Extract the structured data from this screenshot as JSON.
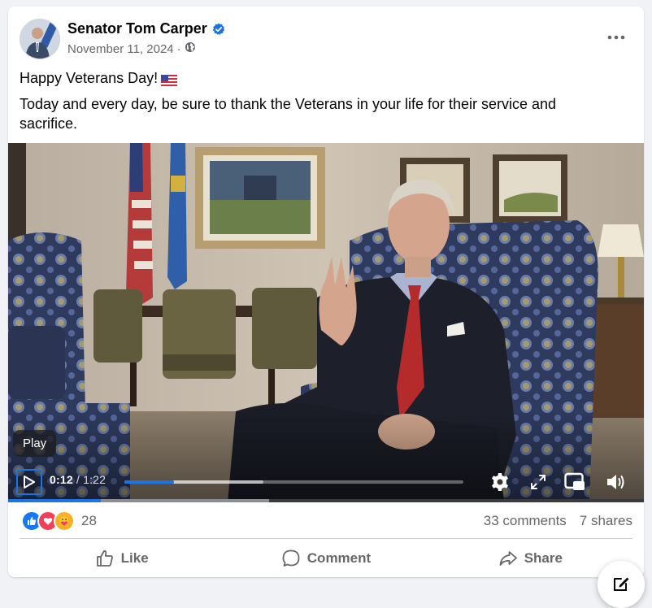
{
  "post": {
    "author": "Senator Tom Carper",
    "date": "November 11, 2024",
    "separator": "·",
    "visibility_icon": "globe-icon",
    "line1": "Happy Veterans Day!",
    "line2": "Today and every day, be sure to thank the Veterans in your life for their service and sacrifice."
  },
  "video": {
    "tooltip": "Play",
    "current_time": "0:12",
    "time_sep": " / ",
    "duration": "1:22",
    "progress_fraction": 0.146,
    "buffered_fraction": 0.41
  },
  "reactions": {
    "count": "28",
    "types": [
      "like-icon",
      "love-icon",
      "care-icon"
    ],
    "comments": "33 comments",
    "shares": "7 shares"
  },
  "actions": {
    "like": "Like",
    "comment": "Comment",
    "share": "Share"
  },
  "colors": {
    "accent": "#1b74e4",
    "like": "#1877f2",
    "love": "#f33e58",
    "care": "#f7b125",
    "secondary_text": "#65676b"
  }
}
